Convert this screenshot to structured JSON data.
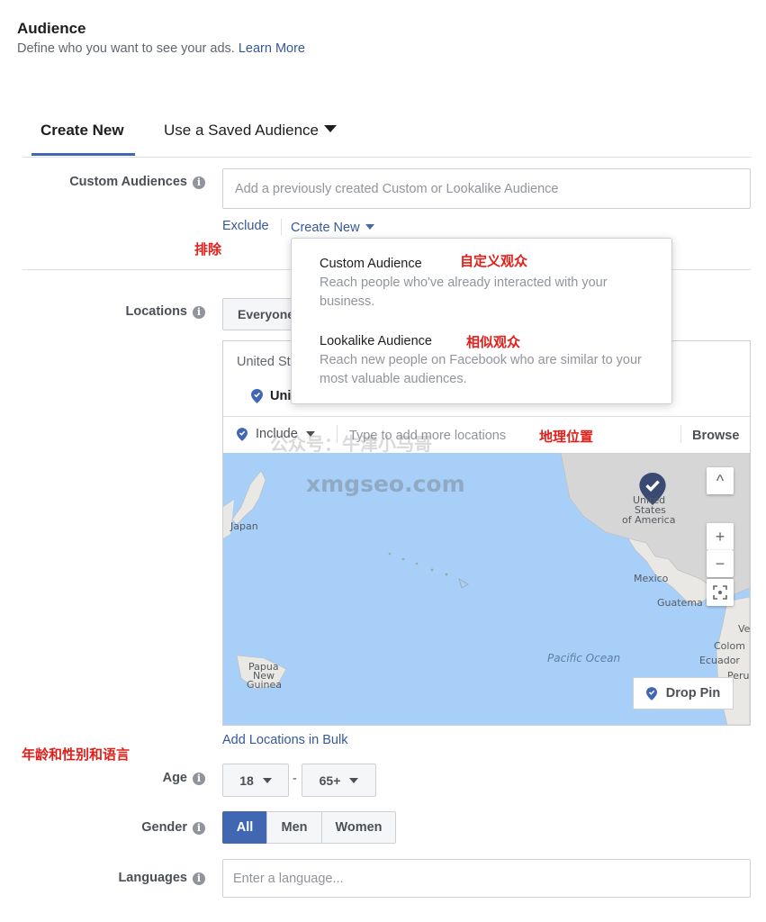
{
  "header": {
    "title": "Audience",
    "subtitle": "Define who you want to see your ads.",
    "learn_more": "Learn More"
  },
  "tabs": {
    "create_new": "Create New",
    "saved": "Use a Saved Audience"
  },
  "custom_audiences": {
    "label": "Custom Audiences",
    "placeholder": "Add a previously created Custom or Lookalike Audience",
    "exclude": "Exclude",
    "create_new": "Create New"
  },
  "dropdown": {
    "items": [
      {
        "title": "Custom Audience",
        "desc": "Reach people who've already interacted with your business."
      },
      {
        "title": "Lookalike Audience",
        "desc": "Reach new people on Facebook who are similar to your most valuable audiences."
      }
    ]
  },
  "annotations": {
    "exclude": "排除",
    "custom": "自定义观众",
    "lookalike": "相似观众",
    "geo": "地理位置",
    "age_gender_lang": "年龄和性别和语言"
  },
  "locations": {
    "label": "Locations",
    "select_value": "Everyone",
    "group_header": "United St",
    "selected_item": "Uni",
    "include": "Include",
    "placeholder": "Type to add more locations",
    "browse": "Browse",
    "add_bulk": "Add Locations in Bulk",
    "drop_pin": "Drop Pin"
  },
  "map": {
    "labels": {
      "japan": "Japan",
      "us1": "United",
      "us2": "States",
      "us3": "of America",
      "mexico": "Mexico",
      "guatemala": "Guatema",
      "colombia": "Colom",
      "venezuela": "Ve",
      "ecuador": "Ecuador",
      "peru": "Peru",
      "pacific": "Pacific Ocean",
      "png1": "Papua",
      "png2": "New",
      "png3": "Guinea"
    },
    "controls": {
      "up": "^",
      "plus": "+",
      "minus": "−"
    }
  },
  "age": {
    "label": "Age",
    "min": "18",
    "max": "65+",
    "separator": "-"
  },
  "gender": {
    "label": "Gender",
    "options": [
      "All",
      "Men",
      "Women"
    ],
    "selected": "All"
  },
  "languages": {
    "label": "Languages",
    "placeholder": "Enter a language..."
  },
  "watermark": {
    "line1": "公众号：牛津小马哥",
    "line2": "xmgseo.com"
  },
  "colors": {
    "accent": "#4267b2",
    "link": "#365899",
    "annotation": "#e0201b",
    "map_water": "#a8cff8"
  }
}
